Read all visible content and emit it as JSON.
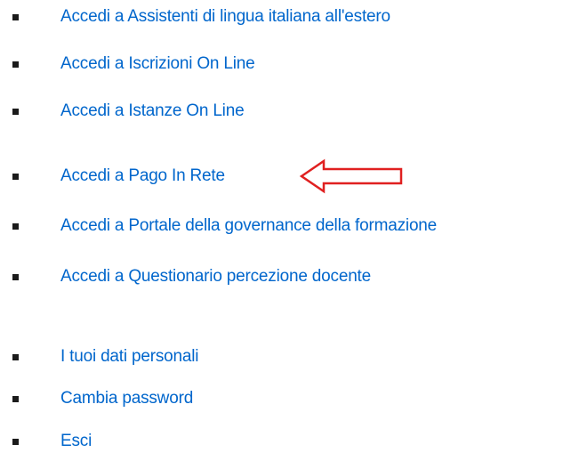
{
  "menu": {
    "items": [
      {
        "label": "Accedi a Assistenti di lingua italiana all'estero"
      },
      {
        "label": "Accedi a Iscrizioni On Line"
      },
      {
        "label": "Accedi a Istanze On Line"
      },
      {
        "label": "Accedi a Pago In Rete"
      },
      {
        "label": "Accedi a Portale della governance della formazione"
      },
      {
        "label": "Accedi a Questionario percezione docente"
      },
      {
        "label": "I tuoi dati personali"
      },
      {
        "label": "Cambia password"
      },
      {
        "label": "Esci"
      }
    ]
  },
  "colors": {
    "link": "#0066cc",
    "bullet": "#1b1b1b",
    "arrow": "#e02020"
  },
  "annotation": {
    "icon": "left-arrow-outline-icon",
    "points_to": "Accedi a Pago In Rete"
  }
}
